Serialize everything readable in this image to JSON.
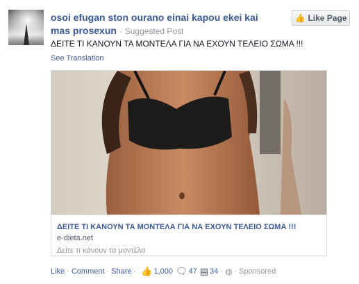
{
  "post": {
    "page_name": "osoi efugan ston ourano einai kapou ekei kai mas prosexun",
    "separator": "·",
    "suggested_label": "Suggested Post",
    "status_text": "ΔΕΙΤΕ ΤΙ ΚΑΝΟΥΝ ΤΑ ΜΟΝΤΕΛΑ ΓΙΑ ΝΑ ΕΧΟΥΝ ΤΕΛΕΙΟ ΣΩΜΑ !!!",
    "see_translation": "See Translation"
  },
  "like_page": {
    "icon": "thumbs-up-icon",
    "label": "Like Page"
  },
  "link_card": {
    "title": "ΔΕΙΤΕ ΤΙ ΚΑΝΟΥΝ ΤΑ ΜΟΝΤΕΛΑ ΓΙΑ ΝΑ ΕΧΟΥΝ ΤΕΛΕΙΟ ΣΩΜΑ !!!",
    "domain": "e-dieta.net",
    "description": "Δείτε τι κάνουν τα μοντέλα"
  },
  "actions": {
    "like": "Like",
    "comment": "Comment",
    "share": "Share",
    "likes_count": "1,000",
    "comments_count": "47",
    "shares_count": "34",
    "sponsored": "Sponsored"
  },
  "colors": {
    "link": "#3b5998",
    "muted": "#90949c",
    "text": "#141823"
  }
}
